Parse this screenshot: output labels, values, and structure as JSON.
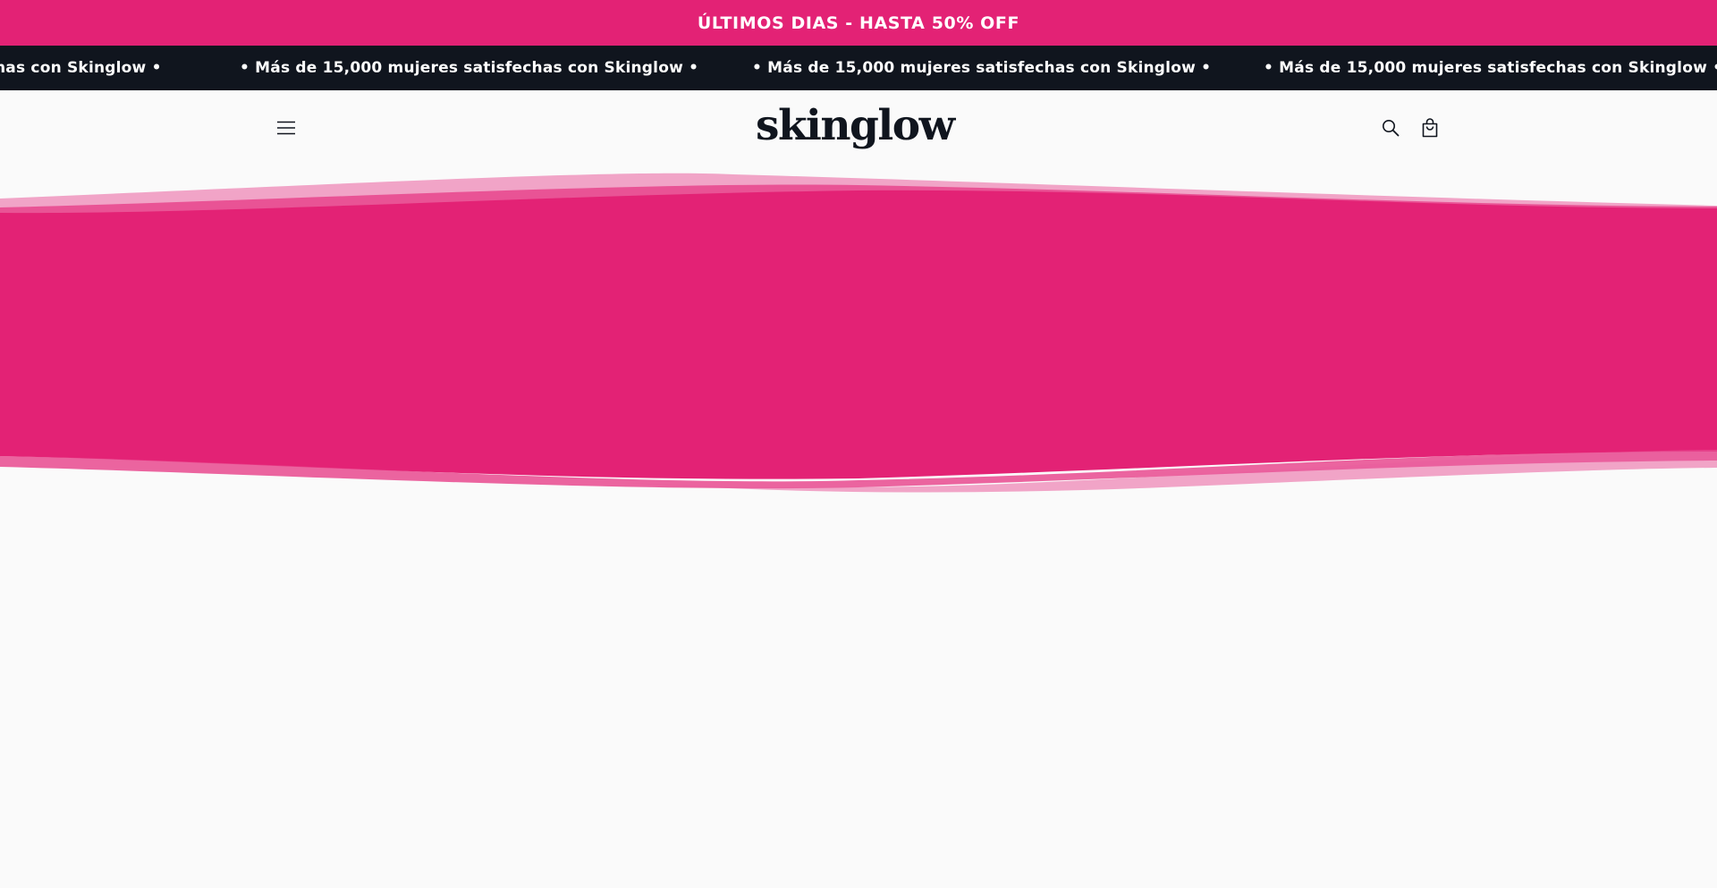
{
  "announcement": {
    "text": "ÚLTIMOS DIAS - HASTA 50% OFF"
  },
  "ticker": {
    "items": [
      "has con Skinglow •",
      "• Más de 15,000 mujeres satisfechas con Skinglow •",
      "• Más de 15,000 mujeres satisfechas con Skinglow •",
      "• Más de 15,000 mujeres satisfechas con Skinglow •"
    ]
  },
  "header": {
    "logo_text": "skinglow",
    "menu_icon": "hamburger-menu-icon",
    "search_icon": "search-icon",
    "cart_icon": "shopping-bag-icon"
  },
  "colors": {
    "brand_pink": "#e32275",
    "ticker_bg": "#10151e",
    "page_bg": "#fafafa"
  }
}
